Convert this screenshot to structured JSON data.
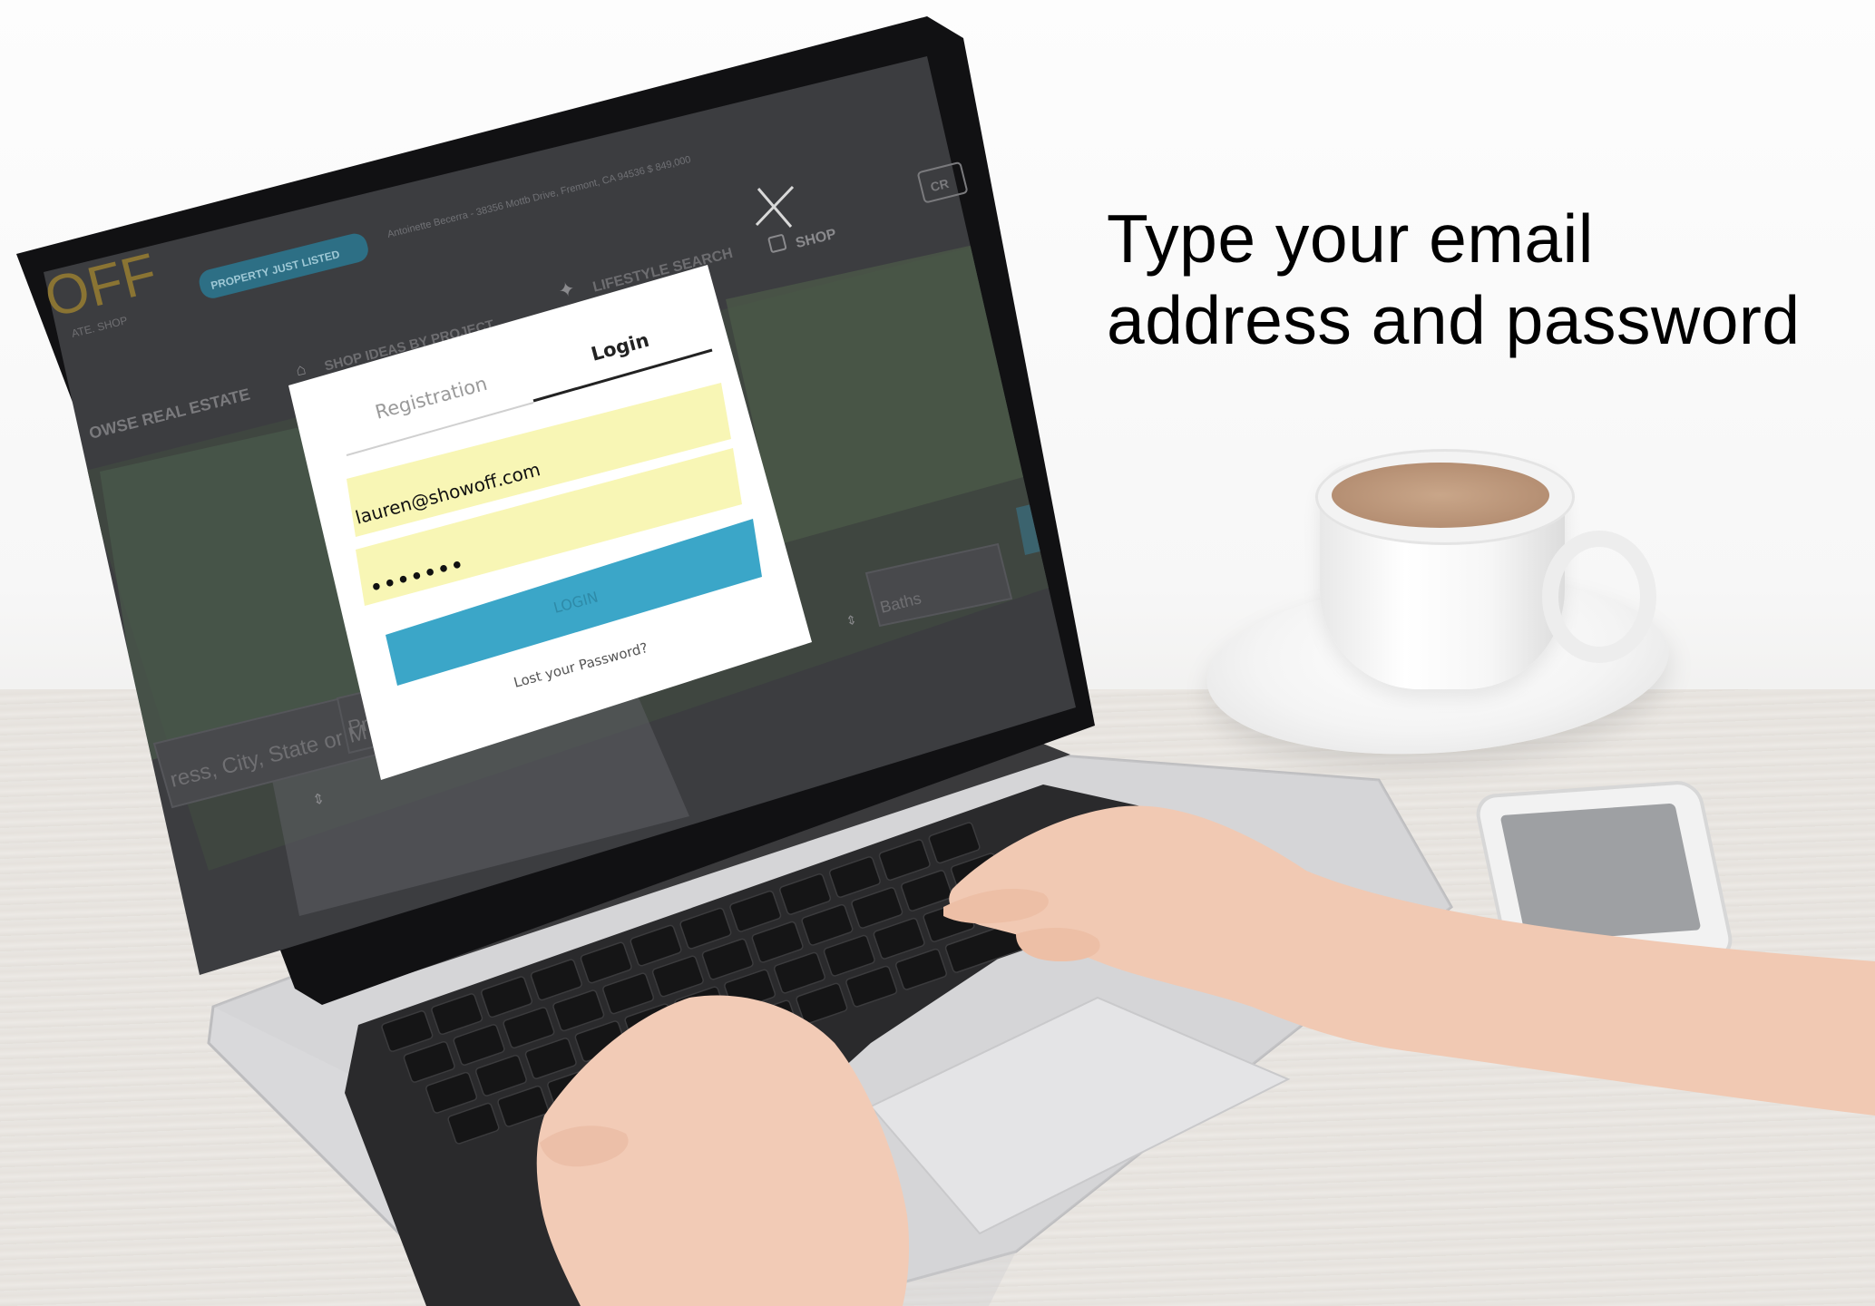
{
  "overlay": {
    "headline_line1": "Type your email",
    "headline_line2": "address and password"
  },
  "site": {
    "logo_text": "OFF",
    "logo_sub": "ATE. SHOP",
    "badge": "PROPERTY JUST LISTED",
    "address": "Antoinette Becerra - 38356 Mottb Drive, Fremont, CA 94536 $ 849,000",
    "nav_shop": "SHOP",
    "nav_lifestyle": "LIFESTYLE SEARCH",
    "nav_ideas": "SHOP IDEAS BY PROJECT",
    "nav_browse": "OWSE REAL ESTATE",
    "cta": "CR",
    "search_placeholder": "ress, City, State or M",
    "price_placeholder": "Pric",
    "baths_placeholder": "Baths"
  },
  "modal": {
    "tab_registration": "Registration",
    "tab_login": "Login",
    "email_value": "lauren@showoff.com",
    "password_value": "•••••••",
    "login_button": "LOGIN",
    "lost_password": "Lost your Password?"
  },
  "colors": {
    "field_fill": "#f8f6b5",
    "button_fill": "#3ba6c8",
    "badge_fill": "#3aa9c9",
    "logo_color": "#c49a3a",
    "dim_overlay": "#3c3d40"
  }
}
